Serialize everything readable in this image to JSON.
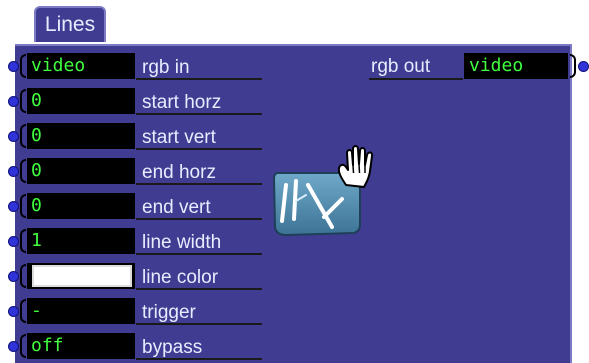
{
  "actor": {
    "title": "Lines",
    "icon": "lines-actor-icon",
    "cursor_icon": "hand-cursor-icon"
  },
  "inputs": [
    {
      "name": "rgb in",
      "value": "video",
      "kind": "text"
    },
    {
      "name": "start horz",
      "value": "0",
      "kind": "text"
    },
    {
      "name": "start vert",
      "value": "0",
      "kind": "text"
    },
    {
      "name": "end horz",
      "value": "0",
      "kind": "text"
    },
    {
      "name": "end vert",
      "value": "0",
      "kind": "text"
    },
    {
      "name": "line width",
      "value": "1",
      "kind": "text"
    },
    {
      "name": "line color",
      "value": "",
      "kind": "color",
      "color": "#ffffff"
    },
    {
      "name": "trigger",
      "value": "-",
      "kind": "text"
    },
    {
      "name": "bypass",
      "value": "off",
      "kind": "text"
    }
  ],
  "output": {
    "name": "rgb out",
    "value": "video"
  },
  "colors": {
    "panel_bg": "#403c92",
    "panel_border": "#7d7bc4",
    "value_text": "#40ff40",
    "label_text": "#e8ecff",
    "port": "#2f33d8"
  }
}
